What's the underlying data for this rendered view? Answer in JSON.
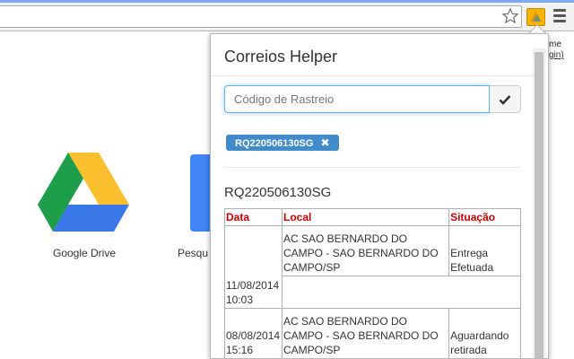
{
  "browser": {
    "extension_icon": "correios-helper-extension-icon",
    "bookmark_icon": "star-icon",
    "menu_icon": "hamburger-menu-icon"
  },
  "new_tab": {
    "apps": [
      {
        "label": "Google Drive",
        "icon": "google-drive-icon"
      },
      {
        "label": "Pesqu"
      }
    ],
    "side_fragment_1": "me",
    "side_fragment_2": "gin)"
  },
  "popup": {
    "title": "Correios Helper",
    "search": {
      "placeholder": "Código de Rastreio",
      "value": "",
      "button_icon": "checkmark-icon"
    },
    "tags": [
      {
        "label": "RQ220506130SG",
        "close_icon": "close-x-icon"
      }
    ],
    "result": {
      "code": "RQ220506130SG",
      "headers": {
        "date": "Data",
        "local": "Local",
        "status": "Situação"
      },
      "rows": [
        {
          "date": "11/08/2014 10:03",
          "local": "AC SAO BERNARDO DO CAMPO - SAO BERNARDO DO CAMPO/SP",
          "status": "Entrega Efetuada"
        },
        {
          "date": "08/08/2014 15:16",
          "local": "AC SAO BERNARDO DO CAMPO - SAO BERNARDO DO CAMPO/SP",
          "status": "Aguardando retirada"
        }
      ]
    }
  },
  "colors": {
    "accent": "#428bca",
    "header_red": "#cc0000",
    "input_focus": "#66afe9"
  }
}
